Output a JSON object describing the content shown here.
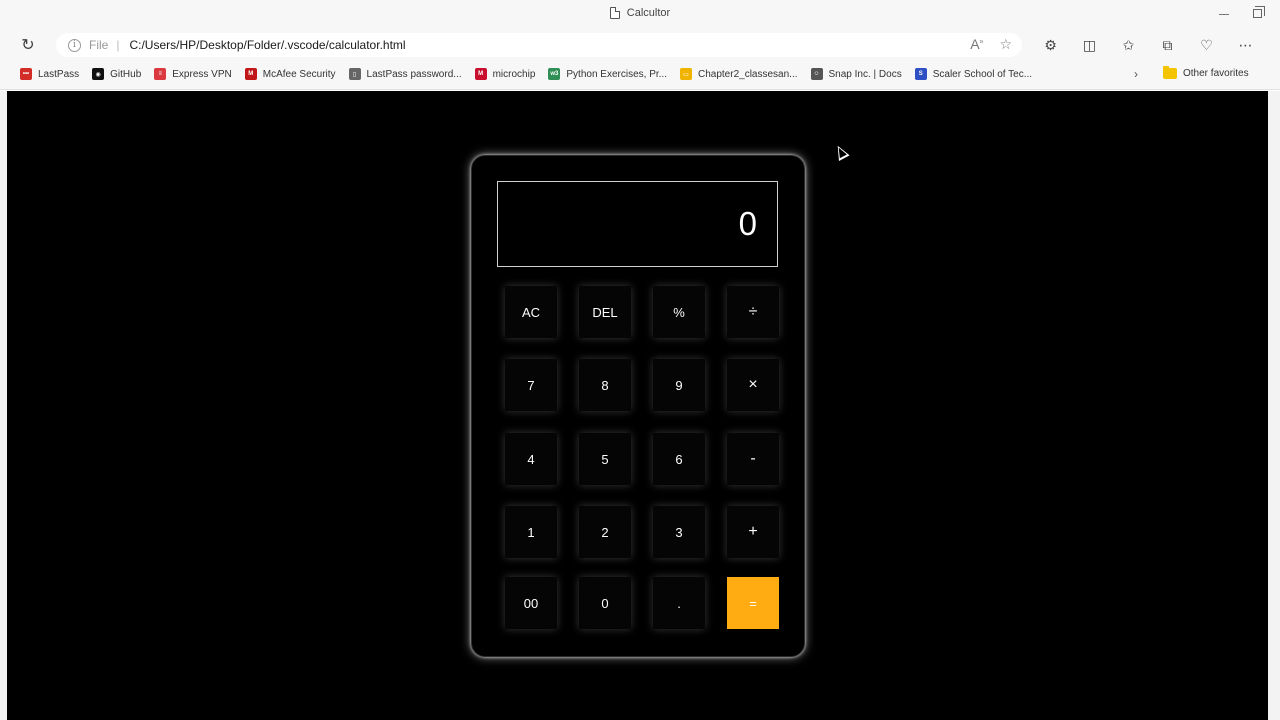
{
  "window": {
    "title": "Calcultor"
  },
  "address_bar": {
    "scheme_label": "File",
    "url": "C:/Users/HP/Desktop/Folder/.vscode/calculator.html"
  },
  "favorites": [
    {
      "label": "LastPass",
      "icon": "lastpass-icon",
      "color": "#d32d27"
    },
    {
      "label": "GitHub",
      "icon": "github-icon",
      "color": "#111111"
    },
    {
      "label": "Express VPN",
      "icon": "expressvpn-icon",
      "color": "#da3940"
    },
    {
      "label": "McAfee Security",
      "icon": "mcafee-icon",
      "color": "#c01818"
    },
    {
      "label": "LastPass password...",
      "icon": "page-icon",
      "color": "#666666"
    },
    {
      "label": "microchip",
      "icon": "microchip-icon",
      "color": "#c8102e"
    },
    {
      "label": "Python Exercises, Pr...",
      "icon": "w3-icon",
      "color": "#2f8f55"
    },
    {
      "label": "Chapter2_classesan...",
      "icon": "folder-doc-icon",
      "color": "#f0b400"
    },
    {
      "label": "Snap Inc. | Docs",
      "icon": "snap-ghost-icon",
      "color": "#555555"
    },
    {
      "label": "Scaler School of Tec...",
      "icon": "scaler-icon",
      "color": "#2f4fc4"
    }
  ],
  "other_favorites": "Other favorites",
  "calculator": {
    "display_value": "0",
    "keys": [
      {
        "label": "AC",
        "name": "ac"
      },
      {
        "label": "DEL",
        "name": "del"
      },
      {
        "label": "%",
        "name": "percent"
      },
      {
        "label": "÷",
        "name": "divide"
      },
      {
        "label": "7",
        "name": "7"
      },
      {
        "label": "8",
        "name": "8"
      },
      {
        "label": "9",
        "name": "9"
      },
      {
        "label": "×",
        "name": "multiply"
      },
      {
        "label": "4",
        "name": "4"
      },
      {
        "label": "5",
        "name": "5"
      },
      {
        "label": "6",
        "name": "6"
      },
      {
        "label": "-",
        "name": "minus"
      },
      {
        "label": "1",
        "name": "1"
      },
      {
        "label": "2",
        "name": "2"
      },
      {
        "label": "3",
        "name": "3"
      },
      {
        "label": "+",
        "name": "plus"
      },
      {
        "label": "00",
        "name": "double-zero"
      },
      {
        "label": "0",
        "name": "0"
      },
      {
        "label": ".",
        "name": "decimal"
      },
      {
        "label": "=",
        "name": "equals"
      }
    ],
    "equals_color": "#ffac13"
  }
}
